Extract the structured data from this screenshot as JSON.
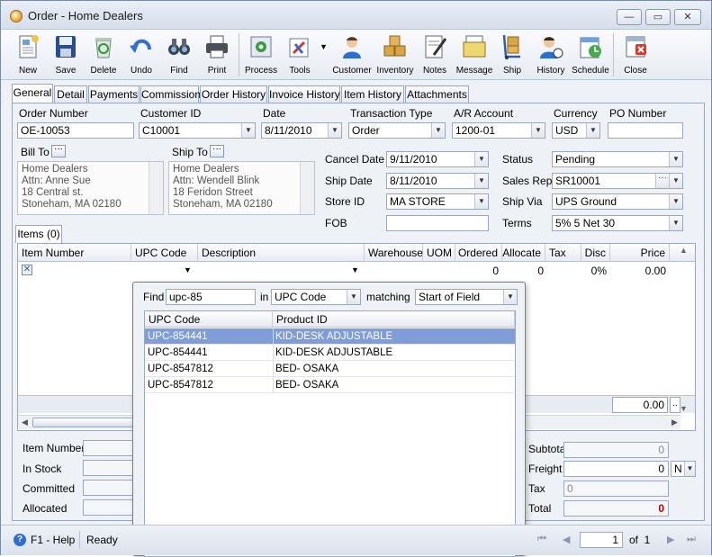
{
  "window": {
    "title": "Order - Home Dealers",
    "minimize": "—",
    "maximize": "▭",
    "close": "✕"
  },
  "toolbar": {
    "new": "New",
    "save": "Save",
    "delete": "Delete",
    "undo": "Undo",
    "find": "Find",
    "print": "Print",
    "process": "Process",
    "tools": "Tools",
    "customer": "Customer",
    "inventory": "Inventory",
    "notes": "Notes",
    "message": "Message",
    "ship": "Ship",
    "history": "History",
    "schedule": "Schedule",
    "close": "Close"
  },
  "tabs": [
    "General",
    "Detail",
    "Payments",
    "Commission",
    "Order History",
    "Invoice History",
    "Item History",
    "Attachments"
  ],
  "header": {
    "order_number_label": "Order Number",
    "order_number": "OE-10053",
    "customer_id_label": "Customer ID",
    "customer_id": "C10001",
    "date_label": "Date",
    "date": "8/11/2010",
    "transaction_type_label": "Transaction Type",
    "transaction_type": "Order",
    "ar_account_label": "A/R Account",
    "ar_account": "1200-01",
    "currency_label": "Currency",
    "currency": "USD",
    "po_number_label": "PO Number",
    "po_number": ""
  },
  "bill_to": {
    "label": "Bill To",
    "address": "Home Dealers\nAttn: Anne Sue\n18 Central st.\nStoneham, MA 02180"
  },
  "ship_to": {
    "label": "Ship To",
    "address": "Home Dealers\nAttn: Wendell Blink\n18 Feridon Street\nStoneham, MA 02180"
  },
  "dates": {
    "cancel_date_label": "Cancel  Date",
    "cancel_date": "9/11/2010",
    "ship_date_label": "Ship Date",
    "ship_date": "8/11/2010",
    "store_id_label": "Store ID",
    "store_id": "MA STORE",
    "fob_label": "FOB",
    "fob": ""
  },
  "order_info": {
    "status_label": "Status",
    "status": "Pending",
    "sales_rep_label": "Sales Rep",
    "sales_rep": "SR10001",
    "ship_via_label": "Ship Via",
    "ship_via": "UPS Ground",
    "terms_label": "Terms",
    "terms": "5% 5 Net 30"
  },
  "items_tab": "Items (0)",
  "grid": {
    "columns": [
      "Item Number",
      "UPC Code",
      "Description",
      "Warehouse",
      "UOM",
      "Ordered",
      "Allocate",
      "Tax",
      "Disc",
      "Price"
    ],
    "row": {
      "ordered": "0",
      "allocate": "0",
      "disc": "0%",
      "price": "0.00"
    },
    "total": "0.00",
    "total_btn": ".."
  },
  "bottom_left": {
    "item_number": "Item Number",
    "in_stock": "In Stock",
    "committed": "Committed",
    "allocated": "Allocated"
  },
  "totals": {
    "subtotal_label": "Subtotal",
    "subtotal": "0",
    "freight_label": "Freight",
    "freight": "0",
    "freight_code": "N",
    "tax_label": "Tax",
    "tax": "0",
    "total_label": "Total",
    "total": "0"
  },
  "find_popup": {
    "find_label": "Find",
    "find_value": "upc-85",
    "in_label": "in",
    "in_value": "UPC Code",
    "matching_label": "matching",
    "matching_value": "Start of Field",
    "columns": [
      "UPC Code",
      "Product ID"
    ],
    "rows": [
      {
        "upc": "UPC-854441",
        "product": "KID-DESK ADJUSTABLE"
      },
      {
        "upc": "UPC-854441",
        "product": "KID-DESK ADJUSTABLE"
      },
      {
        "upc": "UPC-8547812",
        "product": "BED- OSAKA"
      },
      {
        "upc": "UPC-8547812",
        "product": "BED- OSAKA"
      }
    ]
  },
  "status_bar": {
    "help": "F1 - Help",
    "state": "Ready",
    "page": "1",
    "of": "of  1"
  }
}
